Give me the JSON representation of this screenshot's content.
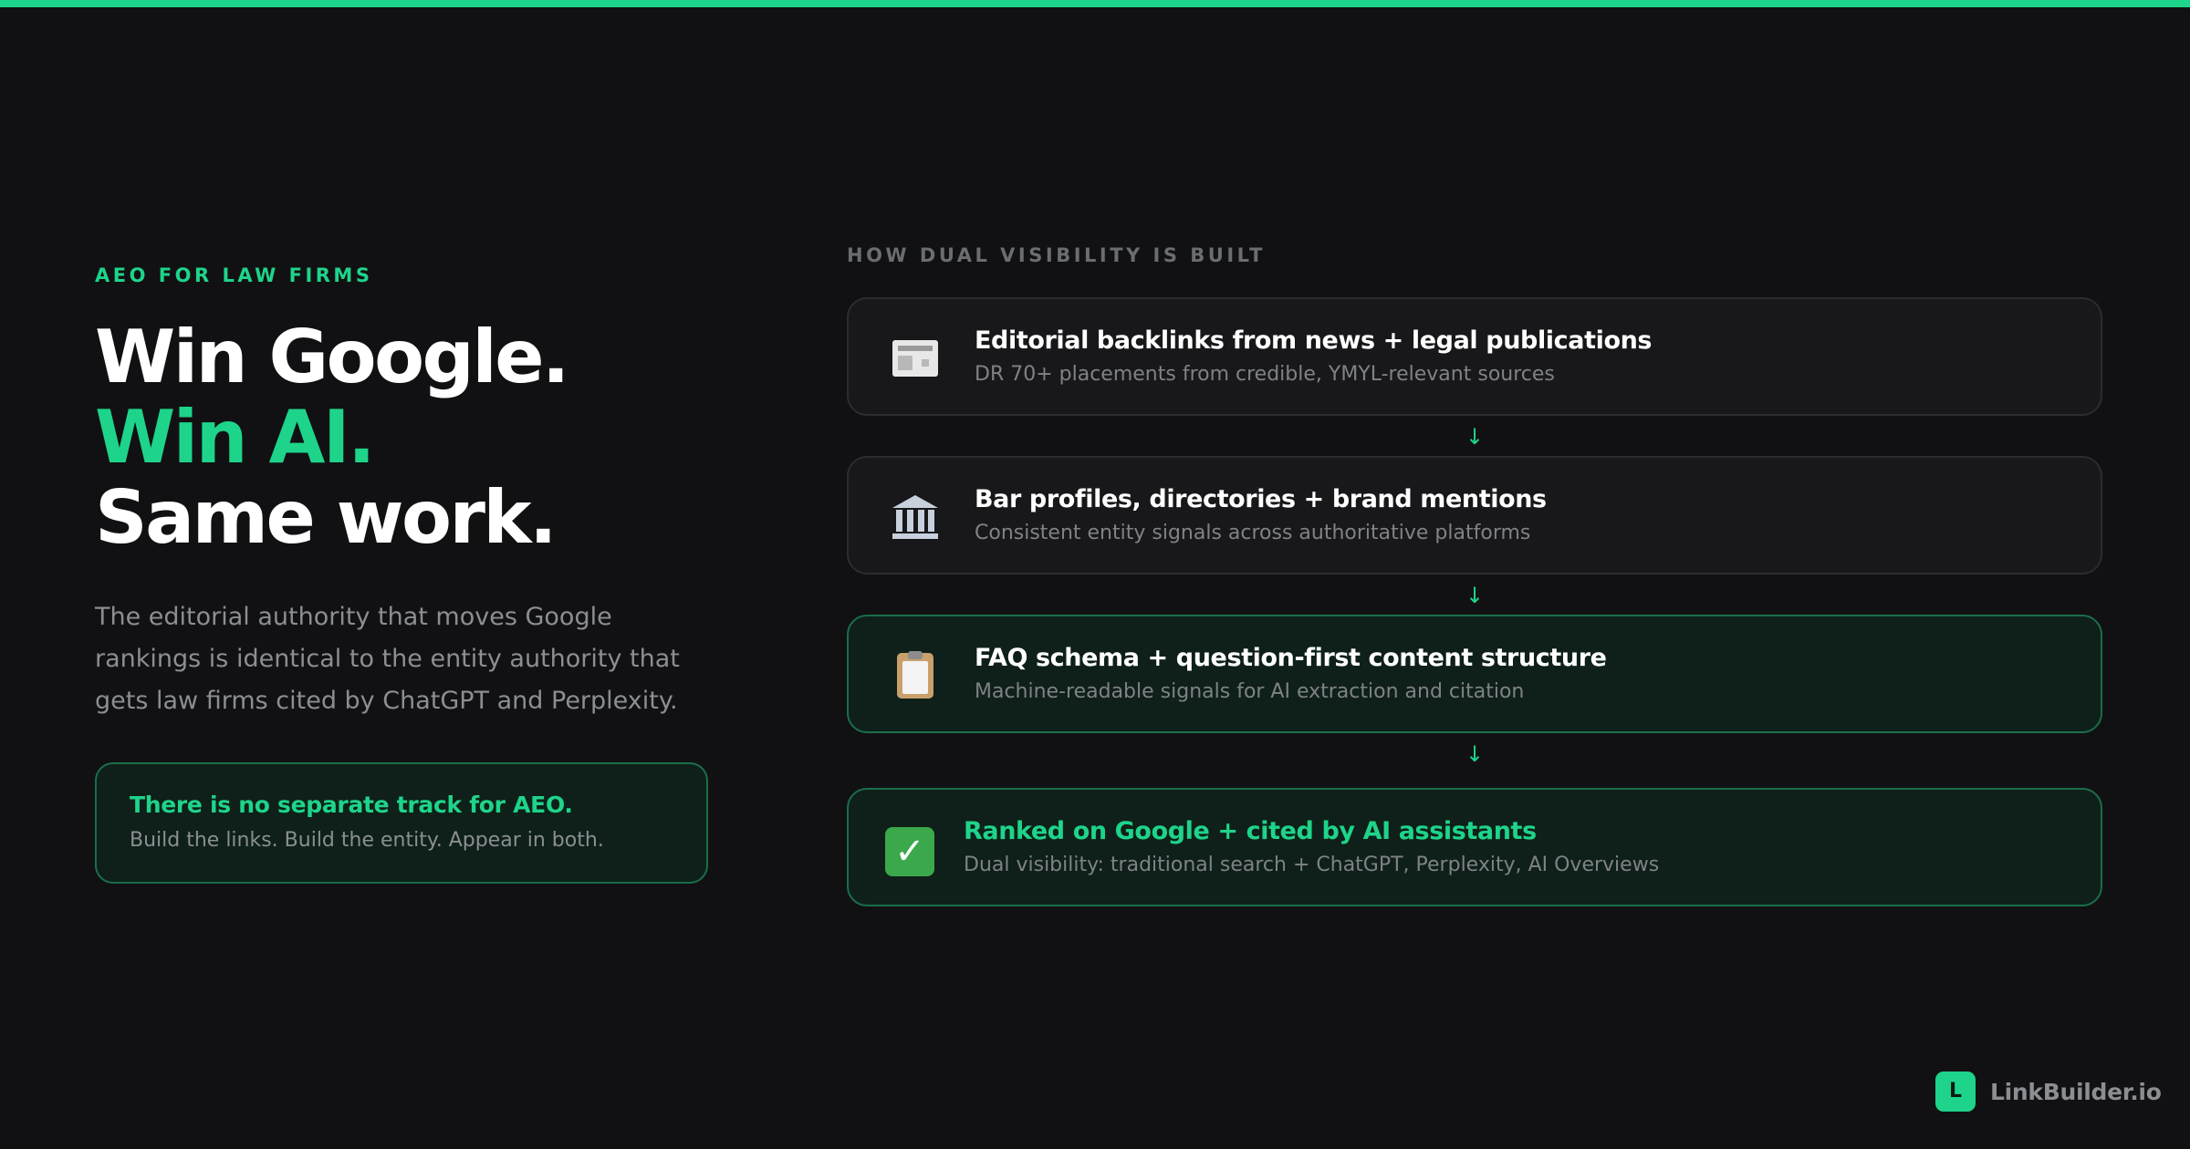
{
  "colors": {
    "accent": "#1ed48a",
    "background": "#111113",
    "card": "#18181b",
    "card_green": "#0e2019",
    "muted_text": "#8b8e92"
  },
  "hero": {
    "eyebrow": "AEO FOR LAW FIRMS",
    "headline_line1": "Win Google.",
    "headline_line2": "Win AI.",
    "headline_line3": "Same work.",
    "lede": "The editorial authority that moves Google rankings is identical to the entity authority that gets law firms cited by ChatGPT and Perplexity."
  },
  "callout": {
    "title": "There is no separate track for AEO.",
    "subtitle": "Build the links. Build the entity. Appear in both."
  },
  "flow": {
    "label": "HOW DUAL VISIBILITY IS BUILT",
    "arrow_glyph": "↓",
    "steps": [
      {
        "icon": "newspaper-icon",
        "title": "Editorial backlinks from news + legal publications",
        "desc": "DR 70+ placements from credible, YMYL-relevant sources"
      },
      {
        "icon": "classical-building-icon",
        "title": "Bar profiles, directories + brand mentions",
        "desc": "Consistent entity signals across authoritative platforms"
      },
      {
        "icon": "clipboard-icon",
        "title": "FAQ schema + question-first content structure",
        "desc": "Machine-readable signals for AI extraction and citation"
      },
      {
        "icon": "check-mark-icon",
        "title": "Ranked on Google + cited by AI assistants",
        "desc": "Dual visibility: traditional search + ChatGPT, Perplexity, AI Overviews"
      }
    ]
  },
  "brand": {
    "badge_letter": "L",
    "name": "LinkBuilder.io"
  }
}
